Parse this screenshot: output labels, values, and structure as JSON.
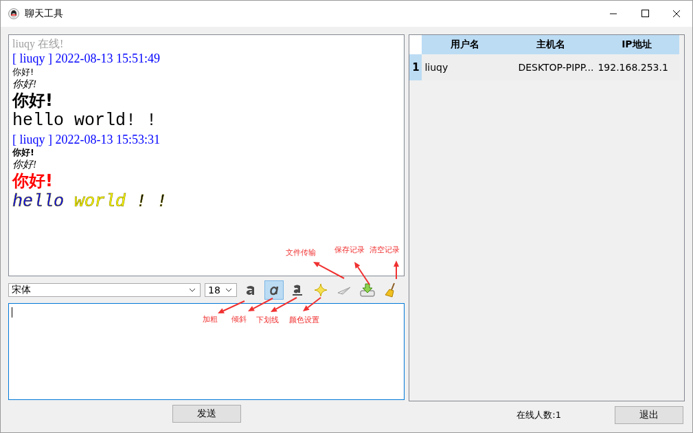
{
  "window": {
    "title": "聊天工具"
  },
  "messages": [
    {
      "kind": "status",
      "segments": [
        {
          "text": "liuqy 在线!",
          "color": "#a0a0a0"
        }
      ]
    },
    {
      "kind": "header",
      "segments": [
        {
          "text": "[ liuqy ] 2022-08-13 15:51:49",
          "color": "#0000ff"
        }
      ]
    },
    {
      "kind": "plain",
      "segments": [
        {
          "text": "你好!",
          "color": "#000000"
        }
      ]
    },
    {
      "kind": "script",
      "segments": [
        {
          "text": "你好!",
          "color": "#000000"
        }
      ]
    },
    {
      "kind": "heavy",
      "segments": [
        {
          "text": "你好!",
          "color": "#000000"
        }
      ]
    },
    {
      "kind": "mono",
      "segments": [
        {
          "text": "hello world! !",
          "color": "#000000"
        }
      ]
    },
    {
      "kind": "header",
      "segments": [
        {
          "text": "[ liuqy ] 2022-08-13 15:53:31",
          "color": "#0000ff"
        }
      ]
    },
    {
      "kind": "bold",
      "segments": [
        {
          "text": "你好!",
          "color": "#000000"
        }
      ]
    },
    {
      "kind": "script",
      "segments": [
        {
          "text": "你好!",
          "color": "#000000"
        }
      ]
    },
    {
      "kind": "heavy",
      "segments": [
        {
          "text": "你好!",
          "color": "#ff0000"
        }
      ]
    },
    {
      "kind": "mono-italic",
      "segments": [
        {
          "text": "hello",
          "color": "#0000ff"
        },
        {
          "text": "world",
          "color": "#ffff00"
        },
        {
          "text": "! !",
          "color": "#000000"
        }
      ]
    }
  ],
  "font_select": {
    "value": "宋体"
  },
  "size_select": {
    "value": "18"
  },
  "tools": [
    {
      "kind": "bold",
      "selected": false
    },
    {
      "kind": "italic",
      "selected": true
    },
    {
      "kind": "underline",
      "selected": false
    },
    {
      "kind": "color",
      "selected": false
    },
    {
      "kind": "send-file",
      "selected": false
    },
    {
      "kind": "save",
      "selected": false
    },
    {
      "kind": "clear",
      "selected": false
    }
  ],
  "annotations": [
    {
      "text": "文件传输",
      "kind": "send-file"
    },
    {
      "text": "保存记录",
      "kind": "save"
    },
    {
      "text": "清空记录",
      "kind": "clear"
    },
    {
      "text": "加粗",
      "kind": "bold"
    },
    {
      "text": "倾斜",
      "kind": "italic"
    },
    {
      "text": "下划线",
      "kind": "underline"
    },
    {
      "text": "颜色设置",
      "kind": "color"
    }
  ],
  "send_button": "发送",
  "table": {
    "columns": [
      "用户名",
      "主机名",
      "IP地址"
    ],
    "rows": [
      {
        "index": "1",
        "cells": [
          "liuqy",
          "DESKTOP-PIPP...",
          "192.168.253.1"
        ]
      }
    ]
  },
  "online_count": "在线人数:1",
  "exit_button": "退出"
}
